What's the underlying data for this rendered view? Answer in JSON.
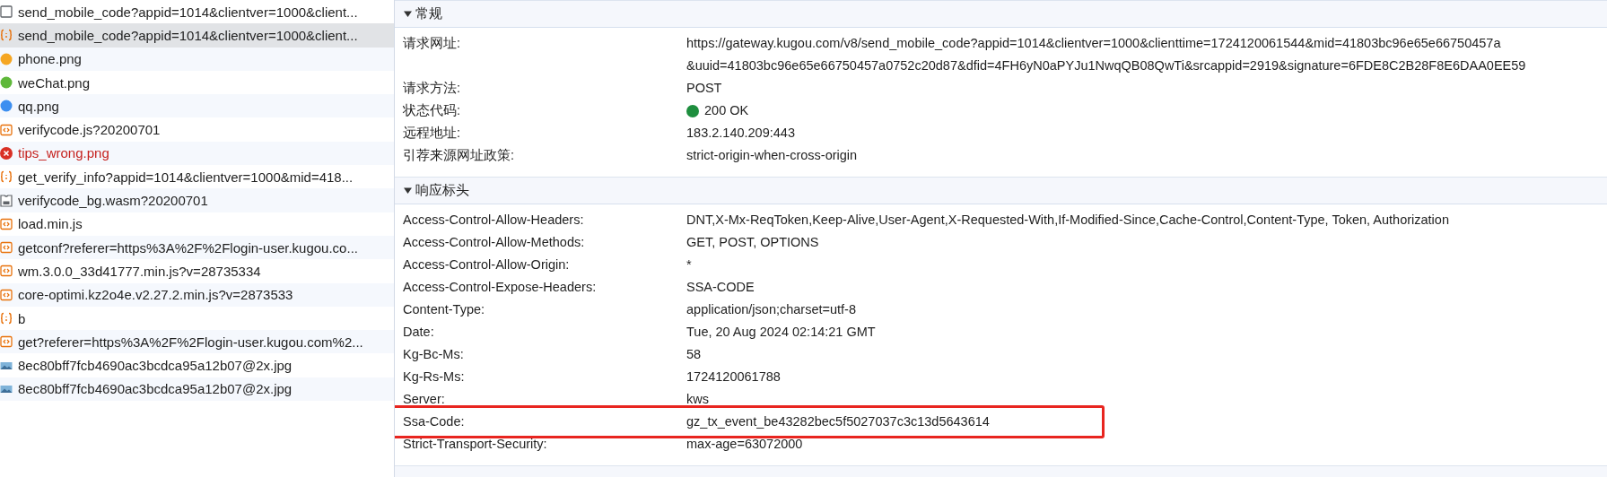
{
  "requests": [
    {
      "name": "send_mobile_code?appid=1014&clientver=1000&client...",
      "kind": "document",
      "selected": false,
      "failed": false
    },
    {
      "name": "send_mobile_code?appid=1014&clientver=1000&client...",
      "kind": "fetch",
      "selected": true,
      "failed": false
    },
    {
      "name": "phone.png",
      "kind": "dot",
      "color": "#f5a623",
      "selected": false,
      "failed": false
    },
    {
      "name": "weChat.png",
      "kind": "dot",
      "color": "#5fb83a",
      "selected": false,
      "failed": false
    },
    {
      "name": "qq.png",
      "kind": "dot",
      "color": "#3d8ff0",
      "selected": false,
      "failed": false
    },
    {
      "name": "verifycode.js?20200701",
      "kind": "script",
      "selected": false,
      "failed": false
    },
    {
      "name": "tips_wrong.png",
      "kind": "error",
      "selected": false,
      "failed": true
    },
    {
      "name": "get_verify_info?appid=1014&clientver=1000&mid=418...",
      "kind": "fetch",
      "selected": false,
      "failed": false
    },
    {
      "name": "verifycode_bg.wasm?20200701",
      "kind": "wasm",
      "selected": false,
      "failed": false
    },
    {
      "name": "load.min.js",
      "kind": "script",
      "selected": false,
      "failed": false
    },
    {
      "name": "getconf?referer=https%3A%2F%2Flogin-user.kugou.co...",
      "kind": "script",
      "selected": false,
      "failed": false
    },
    {
      "name": "wm.3.0.0_33d41777.min.js?v=28735334",
      "kind": "script",
      "selected": false,
      "failed": false
    },
    {
      "name": "core-optimi.kz2o4e.v2.27.2.min.js?v=2873533",
      "kind": "script",
      "selected": false,
      "failed": false
    },
    {
      "name": "b",
      "kind": "fetch",
      "selected": false,
      "failed": false
    },
    {
      "name": "get?referer=https%3A%2F%2Flogin-user.kugou.com%2...",
      "kind": "script",
      "selected": false,
      "failed": false
    },
    {
      "name": "8ec80bff7fcb4690ac3bcdca95a12b07@2x.jpg",
      "kind": "image",
      "selected": false,
      "failed": false
    },
    {
      "name": "8ec80bff7fcb4690ac3bcdca95a12b07@2x.jpg",
      "kind": "image",
      "selected": false,
      "failed": false
    }
  ],
  "general": {
    "title": "常规",
    "expanded": true,
    "rows": [
      {
        "label": "请求网址:",
        "kind": "lines",
        "lines": [
          "https://gateway.kugou.com/v8/send_mobile_code?appid=1014&clientver=1000&clienttime=1724120061544&mid=41803bc96e65e66750457a",
          "&uuid=41803bc96e65e66750457a0752c20d87&dfid=4FH6yN0aPYJu1NwqQB08QwTi&srcappid=2919&signature=6FDE8C2B28F8E6DAA0EE59"
        ]
      },
      {
        "label": "请求方法:",
        "kind": "text",
        "value": "POST"
      },
      {
        "label": "状态代码:",
        "kind": "status",
        "value": "200 OK",
        "color": "#1e8e3e"
      },
      {
        "label": "远程地址:",
        "kind": "text",
        "value": "183.2.140.209:443"
      },
      {
        "label": "引荐来源网址政策:",
        "kind": "text",
        "value": "strict-origin-when-cross-origin"
      }
    ]
  },
  "response_headers": {
    "title": "响应标头",
    "expanded": true,
    "rows": [
      {
        "label": "Access-Control-Allow-Headers:",
        "value": "DNT,X-Mx-ReqToken,Keep-Alive,User-Agent,X-Requested-With,If-Modified-Since,Cache-Control,Content-Type, Token, Authorization",
        "highlighted": false
      },
      {
        "label": "Access-Control-Allow-Methods:",
        "value": "GET, POST, OPTIONS",
        "highlighted": false
      },
      {
        "label": "Access-Control-Allow-Origin:",
        "value": "*",
        "highlighted": false
      },
      {
        "label": "Access-Control-Expose-Headers:",
        "value": "SSA-CODE",
        "highlighted": false
      },
      {
        "label": "Content-Type:",
        "value": "application/json;charset=utf-8",
        "highlighted": false
      },
      {
        "label": "Date:",
        "value": "Tue, 20 Aug 2024 02:14:21 GMT",
        "highlighted": false
      },
      {
        "label": "Kg-Bc-Ms:",
        "value": "58",
        "highlighted": false
      },
      {
        "label": "Kg-Rs-Ms:",
        "value": "1724120061788",
        "highlighted": false
      },
      {
        "label": "Server:",
        "value": "kws",
        "highlighted": false
      },
      {
        "label": "Ssa-Code:",
        "value": "gz_tx_event_be43282bec5f5027037c3c13d5643614",
        "highlighted": true
      },
      {
        "label": "Strict-Transport-Security:",
        "value": "max-age=63072000",
        "highlighted": false
      }
    ]
  }
}
